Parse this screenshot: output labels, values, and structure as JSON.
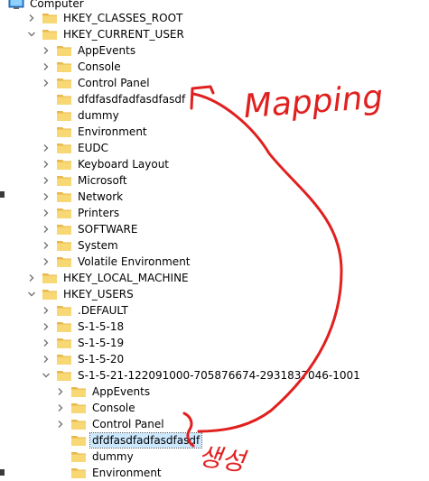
{
  "tree": {
    "root": "Computer",
    "items": [
      {
        "label": "HKEY_CLASSES_ROOT",
        "level": 1,
        "state": "collapsed"
      },
      {
        "label": "HKEY_CURRENT_USER",
        "level": 1,
        "state": "expanded"
      },
      {
        "label": "AppEvents",
        "level": 2,
        "state": "collapsed"
      },
      {
        "label": "Console",
        "level": 2,
        "state": "collapsed"
      },
      {
        "label": "Control Panel",
        "level": 2,
        "state": "collapsed"
      },
      {
        "label": "dfdfasdfadfasdfasdf",
        "level": 2,
        "state": "leaf"
      },
      {
        "label": "dummy",
        "level": 2,
        "state": "leaf"
      },
      {
        "label": "Environment",
        "level": 2,
        "state": "leaf"
      },
      {
        "label": "EUDC",
        "level": 2,
        "state": "collapsed"
      },
      {
        "label": "Keyboard Layout",
        "level": 2,
        "state": "collapsed"
      },
      {
        "label": "Microsoft",
        "level": 2,
        "state": "collapsed"
      },
      {
        "label": "Network",
        "level": 2,
        "state": "collapsed"
      },
      {
        "label": "Printers",
        "level": 2,
        "state": "collapsed"
      },
      {
        "label": "SOFTWARE",
        "level": 2,
        "state": "collapsed"
      },
      {
        "label": "System",
        "level": 2,
        "state": "collapsed"
      },
      {
        "label": "Volatile Environment",
        "level": 2,
        "state": "collapsed"
      },
      {
        "label": "HKEY_LOCAL_MACHINE",
        "level": 1,
        "state": "collapsed"
      },
      {
        "label": "HKEY_USERS",
        "level": 1,
        "state": "expanded"
      },
      {
        "label": ".DEFAULT",
        "level": 2,
        "state": "collapsed"
      },
      {
        "label": "S-1-5-18",
        "level": 2,
        "state": "collapsed"
      },
      {
        "label": "S-1-5-19",
        "level": 2,
        "state": "collapsed"
      },
      {
        "label": "S-1-5-20",
        "level": 2,
        "state": "collapsed"
      },
      {
        "label": "S-1-5-21-122091000-705876674-2931837046-1001",
        "level": 2,
        "state": "expanded"
      },
      {
        "label": "AppEvents",
        "level": 3,
        "state": "collapsed"
      },
      {
        "label": "Console",
        "level": 3,
        "state": "collapsed"
      },
      {
        "label": "Control Panel",
        "level": 3,
        "state": "collapsed"
      },
      {
        "label": "dfdfasdfadfasdfasdf",
        "level": 3,
        "state": "leaf",
        "selected": true
      },
      {
        "label": "dummy",
        "level": 3,
        "state": "leaf"
      },
      {
        "label": "Environment",
        "level": 3,
        "state": "leaf"
      }
    ]
  },
  "annotations": {
    "mapping_text": "Mapping",
    "handwritten_korean": "생성",
    "ink_color": "#e0201f"
  },
  "colors": {
    "selection": "#cce8ff",
    "folder_fill": "#f8d775",
    "folder_tab": "#e7b84a",
    "chevron": "#767676"
  }
}
